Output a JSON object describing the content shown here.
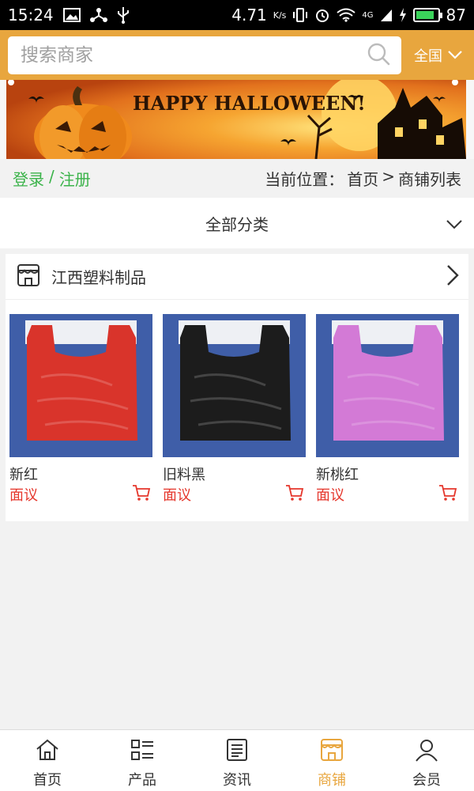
{
  "status_bar": {
    "time": "15:24",
    "speed": "4.71",
    "speed_unit": "K/s",
    "network": "4G",
    "battery": "87",
    "battery_level": 0.87
  },
  "header": {
    "search_placeholder": "搜索商家",
    "search_icon": "search-icon",
    "region_label": "全国",
    "accent_color": "#e8a63e"
  },
  "banner": {
    "text": "HAPPY HALLOWEEN!"
  },
  "breadcrumb": {
    "login": "登录",
    "separator": "/",
    "register": "注册",
    "location_prefix": "当前位置：",
    "home": "首页",
    "arrow": ">",
    "current": "商铺列表"
  },
  "category": {
    "label": "全部分类"
  },
  "store": {
    "name": "江西塑料制品",
    "products": [
      {
        "name": "新红",
        "price": "面议",
        "color": "#d9342b"
      },
      {
        "name": "旧料黑",
        "price": "面议",
        "color": "#1c1c1c"
      },
      {
        "name": "新桃红",
        "price": "面议",
        "color": "#d37ad6"
      }
    ]
  },
  "bottom_nav": {
    "active_color": "#e8a63e",
    "items": [
      {
        "label": "首页",
        "icon": "home-icon"
      },
      {
        "label": "产品",
        "icon": "list-icon"
      },
      {
        "label": "资讯",
        "icon": "news-icon"
      },
      {
        "label": "商铺",
        "icon": "shop-icon"
      },
      {
        "label": "会员",
        "icon": "user-icon"
      }
    ]
  }
}
